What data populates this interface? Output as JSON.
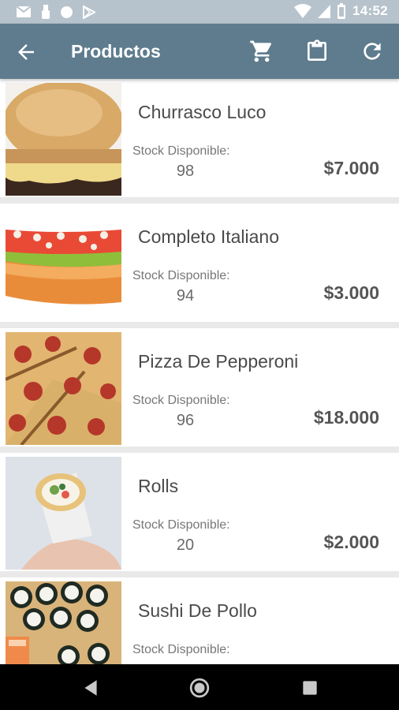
{
  "status_bar": {
    "time": "14:52",
    "left_icons": [
      "mail-icon",
      "usb-icon",
      "circle-icon",
      "play-store-icon"
    ],
    "right_icons": [
      "wifi-icon",
      "signal-icon",
      "battery-icon"
    ]
  },
  "toolbar": {
    "title": "Productos",
    "back_icon": "arrow-back-icon",
    "actions": [
      "cart-icon",
      "clipboard-icon",
      "refresh-icon"
    ]
  },
  "products": [
    {
      "name": "Churrasco Luco",
      "stock_label": "Stock Disponible:",
      "stock": "98",
      "price": "$7.000",
      "image": "churrasco-sandwich"
    },
    {
      "name": "Completo Italiano",
      "stock_label": "Stock Disponible:",
      "stock": "94",
      "price": "$3.000",
      "image": "hot-dog"
    },
    {
      "name": "Pizza De Pepperoni",
      "stock_label": "Stock Disponible:",
      "stock": "96",
      "price": "$18.000",
      "image": "pepperoni-pizza"
    },
    {
      "name": "Rolls",
      "stock_label": "Stock Disponible:",
      "stock": "20",
      "price": "$2.000",
      "image": "wrap-roll"
    },
    {
      "name": "Sushi De Pollo",
      "stock_label": "Stock Disponible:",
      "stock": "",
      "price": "",
      "image": "sushi-platter"
    }
  ],
  "nav_bar": [
    "back-triangle-icon",
    "home-circle-icon",
    "recents-square-icon"
  ]
}
